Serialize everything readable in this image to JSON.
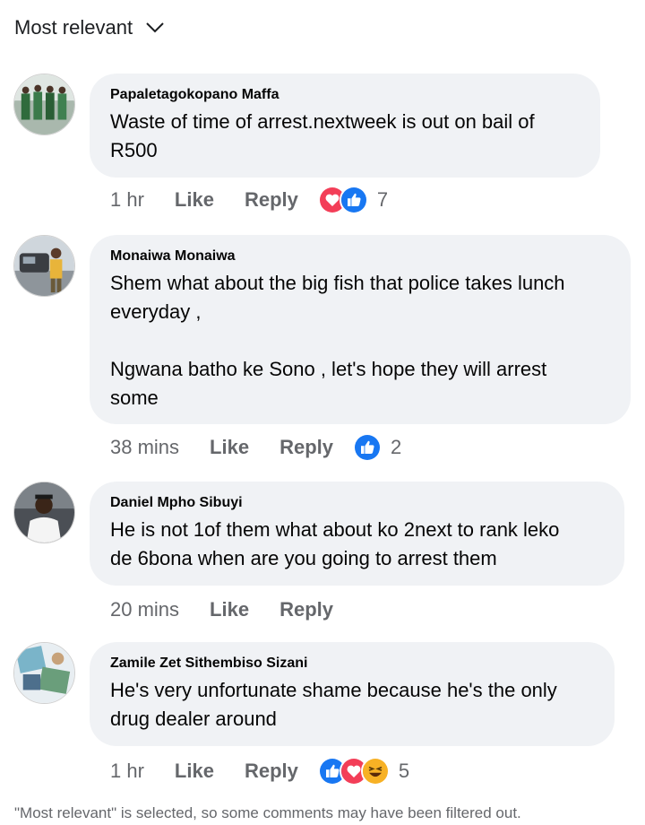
{
  "sort": {
    "label": "Most relevant"
  },
  "comments": [
    {
      "author": "Papaletagokopano Maffa",
      "text": "Waste of time of arrest.nextweek is out on bail of\nR500",
      "time": "1 hr",
      "like_label": "Like",
      "reply_label": "Reply",
      "reactions": [
        "love",
        "like"
      ],
      "reaction_count": "7"
    },
    {
      "author": "Monaiwa Monaiwa",
      "text": "Shem what about the big fish that police takes lunch\neveryday ,\n\nNgwana batho ke Sono , let's hope they will arrest\nsome",
      "time": "38 mins",
      "like_label": "Like",
      "reply_label": "Reply",
      "reactions": [
        "like"
      ],
      "reaction_count": "2"
    },
    {
      "author": "Daniel Mpho Sibuyi",
      "text": "He is not 1of them what about ko 2next to rank leko\nde 6bona when are you going to arrest them",
      "time": "20 mins",
      "like_label": "Like",
      "reply_label": "Reply",
      "reactions": [],
      "reaction_count": ""
    },
    {
      "author": "Zamile Zet Sithembiso Sizani",
      "text": "He's very unfortunate shame because he's the only\ndrug dealer around",
      "time": "1 hr",
      "like_label": "Like",
      "reply_label": "Reply",
      "reactions": [
        "like",
        "love",
        "haha"
      ],
      "reaction_count": "5"
    }
  ],
  "footer": {
    "note": "\"Most relevant\" is selected, so some comments may have been filtered out."
  },
  "colors": {
    "bubble": "#f0f2f5",
    "like_blue": "#1877f2",
    "love_red": "#f33e58",
    "haha_yellow": "#f7b125",
    "meta_gray": "#65676b"
  }
}
